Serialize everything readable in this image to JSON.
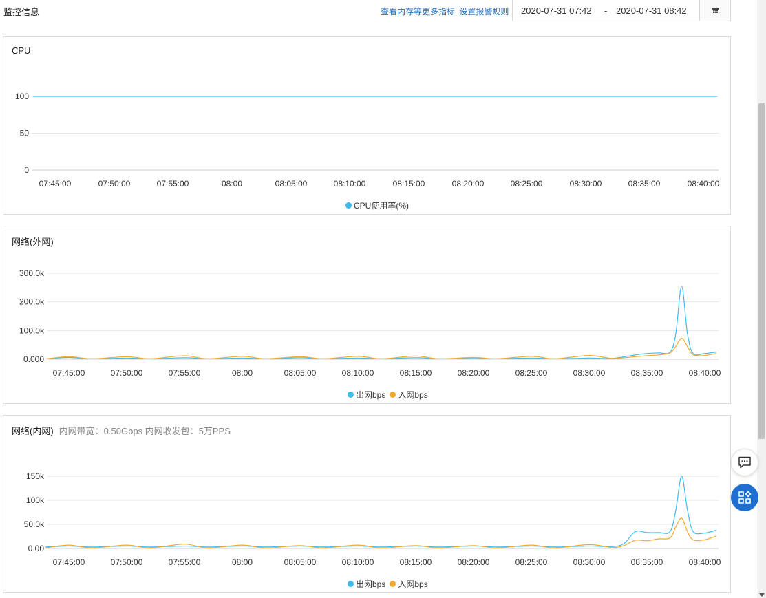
{
  "header": {
    "title": "监控信息",
    "link_memory": "查看内存等更多指标",
    "link_alarm": "设置报警规则",
    "date_start": "2020-07-31 07:42",
    "date_sep": "-",
    "date_end": "2020-07-31 08:42"
  },
  "colors": {
    "out": "#3dbcf0",
    "in": "#f0a92e",
    "grid": "#e6e6e6",
    "axis": "#cccccc",
    "accent": "#1e6fd0"
  },
  "icons": {
    "calendar": "calendar-icon",
    "chat": "chat-icon",
    "apps": "apps-icon"
  },
  "x_ticks": [
    "07:45:00",
    "07:50:00",
    "07:55:00",
    "08:00",
    "08:05:00",
    "08:10:00",
    "08:15:00",
    "08:20:00",
    "08:25:00",
    "08:30:00",
    "08:35:00",
    "08:40:00"
  ],
  "panels": [
    {
      "title": "CPU",
      "subtitle": ""
    },
    {
      "title": "网络(外网)",
      "subtitle": ""
    },
    {
      "title": "网络(内网)",
      "subtitle": "内网带宽：0.50Gbps 内网收发包：5万PPS"
    }
  ],
  "chart_data": [
    {
      "type": "line",
      "title": "CPU",
      "y_ticks": [
        "0",
        "50",
        "100"
      ],
      "ylim": [
        0,
        100
      ],
      "x_ticks": [
        "07:45:00",
        "07:50:00",
        "07:55:00",
        "08:00",
        "08:05:00",
        "08:10:00",
        "08:15:00",
        "08:20:00",
        "08:25:00",
        "08:30:00",
        "08:35:00",
        "08:40:00"
      ],
      "grid": true,
      "legend": "bottom-center",
      "series": [
        {
          "name": "CPU使用率(%)",
          "color": "#3dbcf0",
          "x": [
            "07:43:00",
            "07:48:00",
            "07:53:00",
            "07:58:00",
            "08:03:00",
            "08:08:00",
            "08:13:00",
            "08:18:00",
            "08:23:00",
            "08:28:00",
            "08:33:00",
            "08:38:00",
            "08:41:00"
          ],
          "y": [
            100,
            100,
            100,
            100,
            100,
            100,
            100,
            100,
            100,
            100,
            100,
            100,
            100
          ]
        }
      ]
    },
    {
      "type": "line",
      "title": "网络(外网)",
      "y_ticks": [
        "0.000",
        "100.0k",
        "200.0k",
        "300.0k"
      ],
      "ylim": [
        0,
        300000
      ],
      "x_ticks": [
        "07:45:00",
        "07:50:00",
        "07:55:00",
        "08:00",
        "08:05:00",
        "08:10:00",
        "08:15:00",
        "08:20:00",
        "08:25:00",
        "08:30:00",
        "08:35:00",
        "08:40:00"
      ],
      "grid": true,
      "legend": "bottom-center",
      "series": [
        {
          "name": "出网bps",
          "color": "#3dbcf0",
          "x": [
            "07:43:00",
            "07:45:00",
            "07:47:00",
            "07:50:00",
            "07:52:00",
            "07:55:00",
            "07:57:00",
            "08:00:00",
            "08:02:00",
            "08:05:00",
            "08:07:00",
            "08:10:00",
            "08:12:00",
            "08:15:00",
            "08:17:00",
            "08:20:00",
            "08:22:00",
            "08:25:00",
            "08:27:00",
            "08:30:00",
            "08:32:00",
            "08:34:00",
            "08:35:00",
            "08:36:00",
            "08:37:00",
            "08:37:30",
            "08:38:00",
            "08:38:30",
            "08:39:00",
            "08:40:00",
            "08:41:00"
          ],
          "y": [
            1000,
            6000,
            1500,
            4000,
            1500,
            5000,
            1500,
            4000,
            1500,
            5000,
            1500,
            4000,
            1500,
            5000,
            1500,
            3000,
            1500,
            4000,
            1500,
            4000,
            3000,
            15000,
            20000,
            22000,
            25000,
            90000,
            255000,
            90000,
            20000,
            20000,
            25000
          ]
        },
        {
          "name": "入网bps",
          "color": "#f0a92e",
          "x": [
            "07:43:00",
            "07:45:00",
            "07:47:00",
            "07:50:00",
            "07:52:00",
            "07:55:00",
            "07:57:00",
            "08:00:00",
            "08:02:00",
            "08:05:00",
            "08:07:00",
            "08:10:00",
            "08:12:00",
            "08:15:00",
            "08:17:00",
            "08:20:00",
            "08:22:00",
            "08:25:00",
            "08:27:00",
            "08:30:00",
            "08:32:00",
            "08:34:00",
            "08:35:00",
            "08:36:00",
            "08:37:00",
            "08:37:30",
            "08:38:00",
            "08:38:30",
            "08:39:00",
            "08:40:00",
            "08:41:00"
          ],
          "y": [
            1000,
            9000,
            1500,
            9000,
            1500,
            12000,
            1500,
            10000,
            1500,
            9000,
            1500,
            10000,
            1500,
            11000,
            1500,
            6000,
            1500,
            10000,
            1500,
            13000,
            3000,
            9000,
            12000,
            15000,
            22000,
            45000,
            73000,
            45000,
            15000,
            13000,
            20000
          ]
        }
      ]
    },
    {
      "type": "line",
      "title": "网络(内网)",
      "y_ticks": [
        "0.00",
        "50.0k",
        "100k",
        "150k"
      ],
      "ylim": [
        0,
        150000
      ],
      "x_ticks": [
        "07:45:00",
        "07:50:00",
        "07:55:00",
        "08:00",
        "08:05:00",
        "08:10:00",
        "08:15:00",
        "08:20:00",
        "08:25:00",
        "08:30:00",
        "08:35:00",
        "08:40:00"
      ],
      "grid": true,
      "legend": "bottom-center",
      "series": [
        {
          "name": "出网bps",
          "color": "#3dbcf0",
          "x": [
            "07:43:00",
            "07:45:00",
            "07:47:00",
            "07:50:00",
            "07:52:00",
            "07:55:00",
            "07:57:00",
            "08:00:00",
            "08:02:00",
            "08:05:00",
            "08:07:00",
            "08:10:00",
            "08:12:00",
            "08:15:00",
            "08:17:00",
            "08:20:00",
            "08:22:00",
            "08:25:00",
            "08:27:00",
            "08:30:00",
            "08:32:00",
            "08:33:00",
            "08:34:00",
            "08:35:00",
            "08:36:00",
            "08:37:00",
            "08:37:30",
            "08:38:00",
            "08:38:30",
            "08:39:00",
            "08:40:00",
            "08:41:00"
          ],
          "y": [
            3000,
            5000,
            3000,
            5000,
            3000,
            5000,
            3000,
            5000,
            3000,
            5000,
            3000,
            5000,
            3000,
            5000,
            3000,
            5000,
            3000,
            5000,
            3000,
            5000,
            4000,
            10000,
            35000,
            33000,
            33000,
            35000,
            80000,
            150000,
            80000,
            35000,
            32000,
            38000
          ]
        },
        {
          "name": "入网bps",
          "color": "#f0a92e",
          "x": [
            "07:43:00",
            "07:45:00",
            "07:47:00",
            "07:50:00",
            "07:52:00",
            "07:55:00",
            "07:57:00",
            "08:00:00",
            "08:02:00",
            "08:05:00",
            "08:07:00",
            "08:10:00",
            "08:12:00",
            "08:15:00",
            "08:17:00",
            "08:20:00",
            "08:22:00",
            "08:25:00",
            "08:27:00",
            "08:30:00",
            "08:32:00",
            "08:33:00",
            "08:34:00",
            "08:35:00",
            "08:36:00",
            "08:37:00",
            "08:37:30",
            "08:38:00",
            "08:38:30",
            "08:39:00",
            "08:40:00",
            "08:41:00"
          ],
          "y": [
            1000,
            7000,
            1000,
            7000,
            1000,
            9000,
            1000,
            7000,
            1000,
            6000,
            1000,
            7000,
            1000,
            6000,
            1000,
            6000,
            1000,
            7000,
            1000,
            8000,
            2000,
            6000,
            17000,
            16000,
            20000,
            22000,
            45000,
            63000,
            35000,
            18000,
            18000,
            26000
          ]
        }
      ]
    }
  ]
}
